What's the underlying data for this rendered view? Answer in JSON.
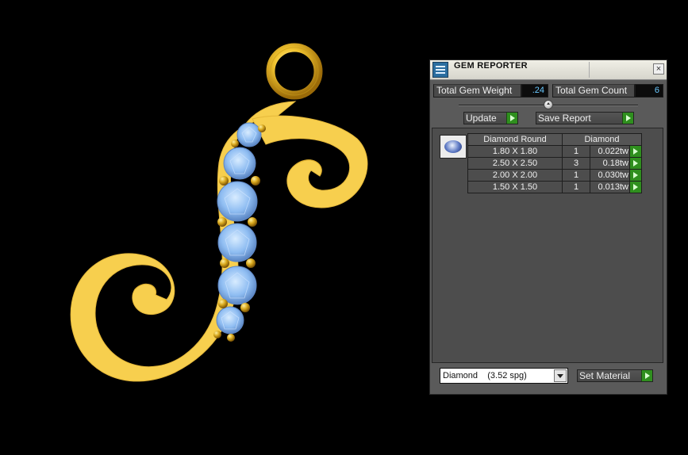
{
  "panel": {
    "title": "GEM REPORTER",
    "close_label": "×",
    "total_weight_label": "Total Gem Weight",
    "total_weight_value": ".24",
    "total_count_label": "Total Gem Count",
    "total_count_value": "6",
    "update_label": "Update",
    "save_report_label": "Save Report",
    "table_headers": {
      "shape": "Diamond Round",
      "material": "Diamond"
    },
    "rows": [
      {
        "size": "1.80 X 1.80",
        "count": "1",
        "weight": "0.022tw"
      },
      {
        "size": "2.50 X 2.50",
        "count": "3",
        "weight": "0.18tw"
      },
      {
        "size": "2.00 X 2.00",
        "count": "1",
        "weight": "0.030tw"
      },
      {
        "size": "1.50 X 1.50",
        "count": "1",
        "weight": "0.013tw"
      }
    ],
    "material_selected": "Diamond    (3.52 spg)",
    "set_material_label": "Set Material"
  },
  "colors": {
    "gold": "#f7cf4e",
    "gem": "#8fbdf2",
    "panel_bg": "#5a5a5a",
    "value_text": "#6ac9ff",
    "play_green": "#2f8f1e"
  },
  "icons": [
    "gem-reporter-app-icon",
    "close-icon",
    "play-arrow-icon",
    "diamond-gem-icon",
    "dropdown-arrow-icon"
  ]
}
